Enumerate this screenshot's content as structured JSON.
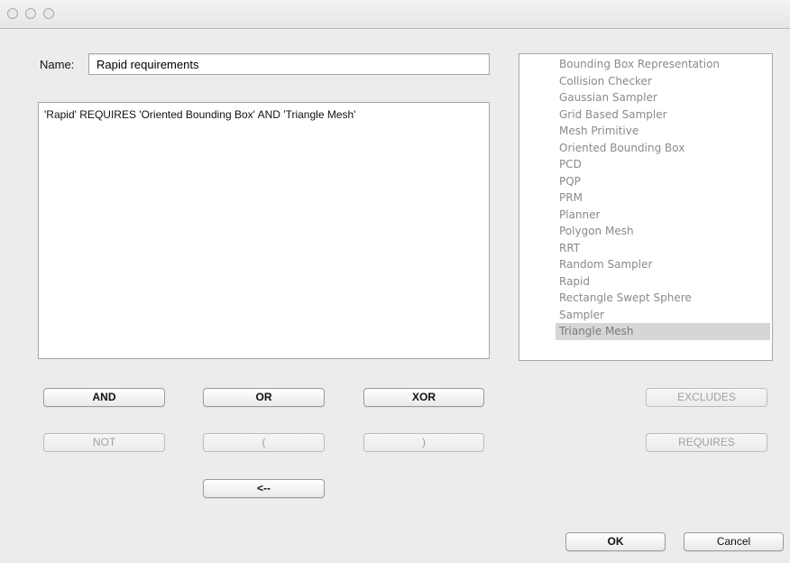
{
  "window": {
    "title": ""
  },
  "name": {
    "label": "Name:",
    "value": "Rapid requirements"
  },
  "expression": {
    "text": "'Rapid' REQUIRES 'Oriented Bounding Box' AND 'Triangle Mesh'"
  },
  "features": {
    "items": [
      "Bounding Box Representation",
      "Collision Checker",
      "Gaussian Sampler",
      "Grid Based Sampler",
      "Mesh Primitive",
      "Oriented Bounding Box",
      "PCD",
      "PQP",
      "PRM",
      "Planner",
      "Polygon Mesh",
      "RRT",
      "Random Sampler",
      "Rapid",
      "Rectangle Swept Sphere",
      "Sampler",
      "Triangle Mesh"
    ],
    "selected_index": 16
  },
  "operators": {
    "and": "AND",
    "or": "OR",
    "xor": "XOR",
    "not": "NOT",
    "open_paren": "(",
    "close_paren": ")",
    "back": "<--",
    "excludes": "EXCLUDES",
    "requires": "REQUIRES"
  },
  "dialog": {
    "ok": "OK",
    "cancel": "Cancel"
  }
}
